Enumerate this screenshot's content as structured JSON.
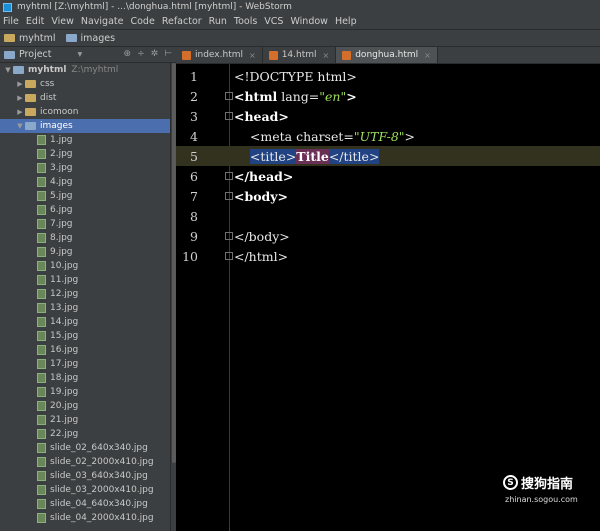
{
  "window": {
    "title": "myhtml [Z:\\myhtml] - ...\\donghua.html [myhtml] - WebStorm"
  },
  "menu": [
    "File",
    "Edit",
    "View",
    "Navigate",
    "Code",
    "Refactor",
    "Run",
    "Tools",
    "VCS",
    "Window",
    "Help"
  ],
  "navbar": {
    "root": "myhtml",
    "child": "images"
  },
  "project_panel": {
    "label": "Project",
    "dropdown": "▾",
    "icons": [
      "⊕",
      "÷",
      "✲",
      "⊢"
    ]
  },
  "tree": [
    {
      "label": "myhtml",
      "sub": "Z:\\myhtml",
      "depth": 0,
      "kind": "folder",
      "expanded": true
    },
    {
      "label": "css",
      "depth": 1,
      "kind": "folder"
    },
    {
      "label": "dist",
      "depth": 1,
      "kind": "folder"
    },
    {
      "label": "icomoon",
      "depth": 1,
      "kind": "folder"
    },
    {
      "label": "images",
      "depth": 1,
      "kind": "folder",
      "expanded": true,
      "selected": true
    },
    {
      "label": "1.jpg",
      "depth": 2,
      "kind": "file"
    },
    {
      "label": "2.jpg",
      "depth": 2,
      "kind": "file"
    },
    {
      "label": "3.jpg",
      "depth": 2,
      "kind": "file"
    },
    {
      "label": "4.jpg",
      "depth": 2,
      "kind": "file"
    },
    {
      "label": "5.jpg",
      "depth": 2,
      "kind": "file"
    },
    {
      "label": "6.jpg",
      "depth": 2,
      "kind": "file"
    },
    {
      "label": "7.jpg",
      "depth": 2,
      "kind": "file"
    },
    {
      "label": "8.jpg",
      "depth": 2,
      "kind": "file"
    },
    {
      "label": "9.jpg",
      "depth": 2,
      "kind": "file"
    },
    {
      "label": "10.jpg",
      "depth": 2,
      "kind": "file"
    },
    {
      "label": "11.jpg",
      "depth": 2,
      "kind": "file"
    },
    {
      "label": "12.jpg",
      "depth": 2,
      "kind": "file"
    },
    {
      "label": "13.jpg",
      "depth": 2,
      "kind": "file"
    },
    {
      "label": "14.jpg",
      "depth": 2,
      "kind": "file"
    },
    {
      "label": "15.jpg",
      "depth": 2,
      "kind": "file"
    },
    {
      "label": "16.jpg",
      "depth": 2,
      "kind": "file"
    },
    {
      "label": "17.jpg",
      "depth": 2,
      "kind": "file"
    },
    {
      "label": "18.jpg",
      "depth": 2,
      "kind": "file"
    },
    {
      "label": "19.jpg",
      "depth": 2,
      "kind": "file"
    },
    {
      "label": "20.jpg",
      "depth": 2,
      "kind": "file"
    },
    {
      "label": "21.jpg",
      "depth": 2,
      "kind": "file"
    },
    {
      "label": "22.jpg",
      "depth": 2,
      "kind": "file"
    },
    {
      "label": "slide_02_640x340.jpg",
      "depth": 2,
      "kind": "file"
    },
    {
      "label": "slide_02_2000x410.jpg",
      "depth": 2,
      "kind": "file"
    },
    {
      "label": "slide_03_640x340.jpg",
      "depth": 2,
      "kind": "file"
    },
    {
      "label": "slide_03_2000x410.jpg",
      "depth": 2,
      "kind": "file"
    },
    {
      "label": "slide_04_640x340.jpg",
      "depth": 2,
      "kind": "file"
    },
    {
      "label": "slide_04_2000x410.jpg",
      "depth": 2,
      "kind": "file"
    }
  ],
  "tabs": [
    {
      "label": "index.html",
      "close": "×"
    },
    {
      "label": "14.html",
      "close": "×"
    },
    {
      "label": "donghua.html",
      "close": "×",
      "active": true
    }
  ],
  "code_lines": [
    {
      "num": "1",
      "parts": [
        [
          "tag",
          "<!DOCTYPE html>"
        ]
      ]
    },
    {
      "num": "2",
      "fold": true,
      "parts": [
        [
          "kw",
          "<html"
        ],
        [
          "attr",
          " lang="
        ],
        [
          "val",
          "\"en\""
        ],
        [
          "kw",
          ">"
        ]
      ]
    },
    {
      "num": "3",
      "fold": true,
      "parts": [
        [
          "kw",
          "<head>"
        ]
      ]
    },
    {
      "num": "4",
      "parts": [
        [
          "ind",
          "    "
        ],
        [
          "tag",
          "<meta"
        ],
        [
          "attr",
          " charset="
        ],
        [
          "val",
          "\"UTF-8\""
        ],
        [
          "tag",
          ">"
        ]
      ]
    },
    {
      "num": "5",
      "current": true,
      "parts": [
        [
          "ind",
          "    "
        ],
        [
          "sel",
          "<title>"
        ],
        [
          "hl",
          "Title"
        ],
        [
          "sel",
          "</title>"
        ]
      ]
    },
    {
      "num": "6",
      "fold": true,
      "parts": [
        [
          "kw",
          "</head>"
        ]
      ]
    },
    {
      "num": "7",
      "fold": true,
      "parts": [
        [
          "kw",
          "<body>"
        ]
      ]
    },
    {
      "num": "8",
      "parts": []
    },
    {
      "num": "9",
      "fold": true,
      "parts": [
        [
          "tag",
          "</body>"
        ]
      ]
    },
    {
      "num": "10",
      "fold": true,
      "parts": [
        [
          "tag",
          "</html>"
        ]
      ]
    }
  ],
  "watermark": {
    "logo": "S",
    "text": "搜狗指南",
    "url": "zhinan.sogou.com"
  }
}
